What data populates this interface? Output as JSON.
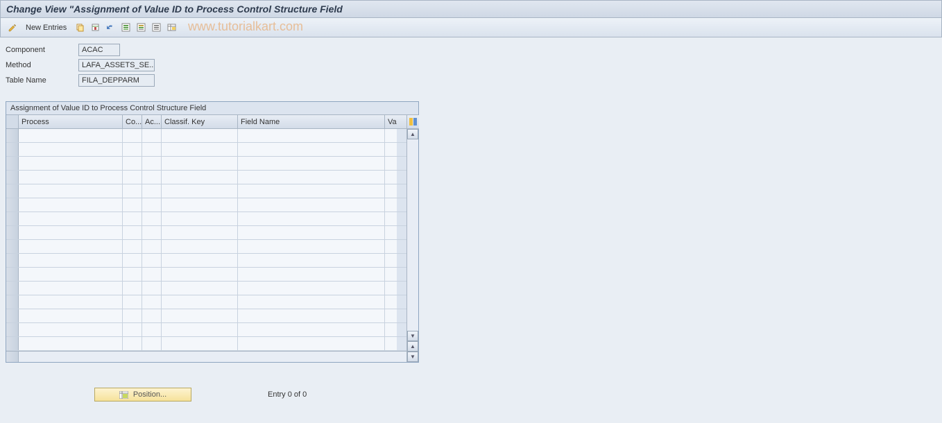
{
  "title": "Change View \"Assignment of Value ID to Process Control Structure Field",
  "toolbar": {
    "new_entries": "New Entries"
  },
  "watermark": "www.tutorialkart.com",
  "form": {
    "component_label": "Component",
    "component_value": "ACAC",
    "method_label": "Method",
    "method_value": "LAFA_ASSETS_SE...",
    "table_label": "Table Name",
    "table_value": "FILA_DEPPARM"
  },
  "table": {
    "title": "Assignment of Value ID to Process Control Structure Field",
    "headers": {
      "process": "Process",
      "co": "Co...",
      "ac": "Ac...",
      "classif": "Classif. Key",
      "field": "Field Name",
      "val": "Va"
    },
    "rows": [
      "",
      "",
      "",
      "",
      "",
      "",
      "",
      "",
      "",
      "",
      "",
      "",
      "",
      "",
      "",
      ""
    ]
  },
  "footer": {
    "position": "Position...",
    "entry": "Entry 0 of 0"
  }
}
